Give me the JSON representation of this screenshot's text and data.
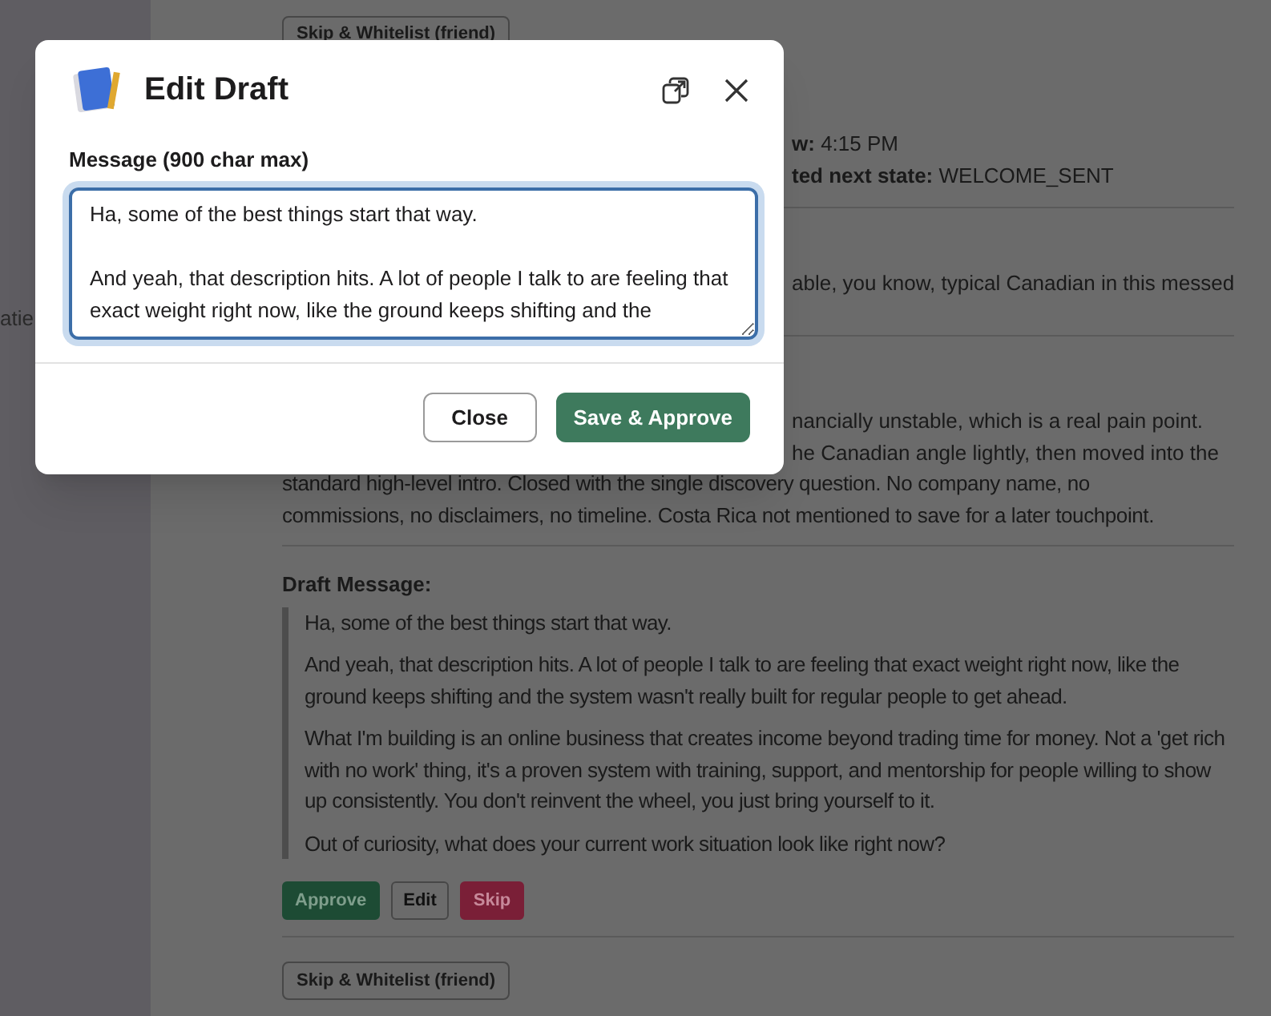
{
  "sidebar": {
    "items": [
      {
        "label": "atie"
      }
    ]
  },
  "feed": {
    "top_button": "Skip & Whitelist (friend)",
    "meta_lines": [
      {
        "label": "w:",
        "value": "4:15 PM"
      },
      {
        "label": "ted next state:",
        "value": "WELCOME_SENT"
      }
    ],
    "summary_fragment": "able, you know, typical Canadian in this messed",
    "notes_lines": [
      {
        "kind": "partial",
        "text": "nancially unstable, which is a real pain point."
      },
      {
        "kind": "partial",
        "text": "he Canadian angle lightly, then moved into the"
      },
      {
        "kind": "full",
        "text": "standard high-level intro. Closed with the single discovery question. No company name, no"
      },
      {
        "kind": "full",
        "text": "commissions, no disclaimers, no timeline. Costa Rica not mentioned to save for a later touchpoint."
      }
    ],
    "draft": {
      "heading": "Draft Message:",
      "paragraphs": [
        "Ha, some of the best things start that way.",
        "And yeah, that description hits. A lot of people I talk to are feeling that exact weight right now, like the ground keeps shifting and the system wasn't really built for regular people to get ahead.",
        "What I'm building is an online business that creates income beyond trading time for money. Not a 'get rich with no work' thing, it's a proven system with training, support, and mentorship for people willing to show up consistently. You don't reinvent the wheel, you just bring yourself to it.",
        "Out of curiosity, what does your current work situation look like right now?"
      ]
    },
    "actions": [
      {
        "label": "Approve",
        "kind": "approve"
      },
      {
        "label": "Edit",
        "kind": "edit"
      },
      {
        "label": "Skip",
        "kind": "skip"
      }
    ],
    "bottom_button": "Skip & Whitelist (friend)"
  },
  "modal": {
    "title": "Edit Draft",
    "field_label": "Message (900 char max)",
    "message": "Ha, some of the best things start that way.\n\nAnd yeah, that description hits. A lot of people I talk to are feeling that exact weight right now, like the ground keeps shifting and the",
    "buttons": [
      {
        "label": "Close",
        "kind": "secondary"
      },
      {
        "label": "Save & Approve",
        "kind": "primary"
      }
    ]
  }
}
